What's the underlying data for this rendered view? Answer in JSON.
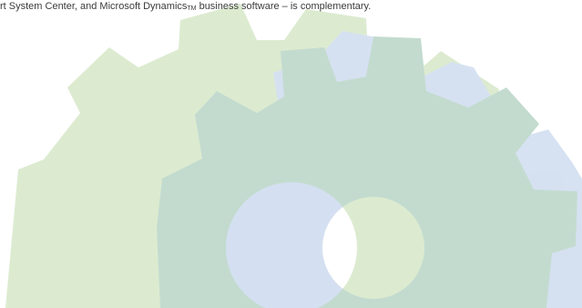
{
  "caption": {
    "before": "rt System Center, and Microsoft Dynamics",
    "mark": "TM",
    "after": " business software – is complementary."
  },
  "colors": {
    "background": "#ffffff",
    "text": "#3b3b3b",
    "gear_green": "#dcebd0",
    "gear_blue": "#d4e0f1",
    "gear_teal": "#c3dbcf",
    "hole_blue": "#d4e0f1",
    "hole_green": "#dcebd0",
    "hole_overlap": "#ffffff"
  },
  "icons": [
    "green-gear-icon",
    "blue-gear-icon",
    "teal-gear-icon"
  ]
}
